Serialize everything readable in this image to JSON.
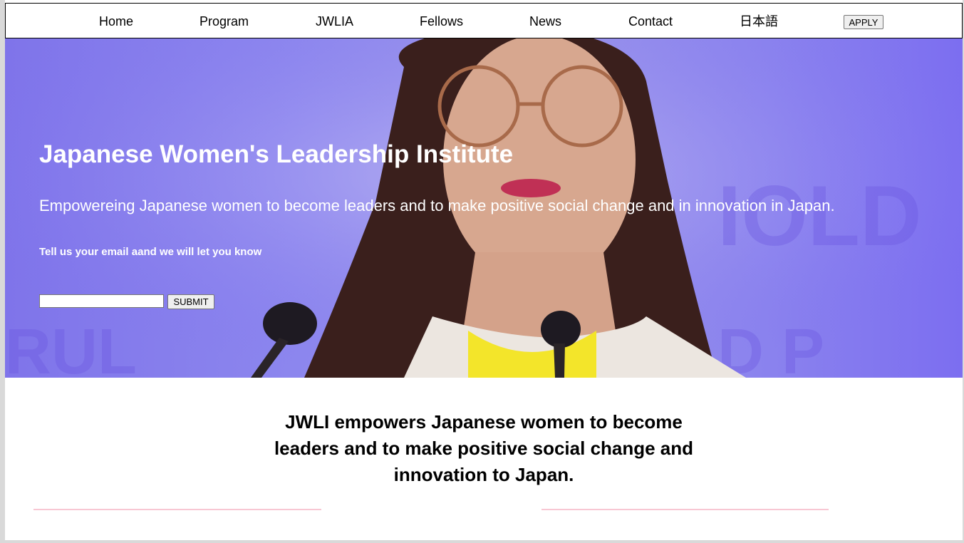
{
  "nav": {
    "items": [
      "Home",
      "Program",
      "JWLIA",
      "Fellows",
      "News",
      "Contact",
      "日本語"
    ],
    "apply_label": "APPLY"
  },
  "hero": {
    "title": "Japanese Women's Leadership Institute",
    "subtitle": "Empowereing Japanese women to become leaders and to make positive social change and in innovation in Japan.",
    "email_prompt": "Tell us your email aand we will let you know",
    "email_placeholder": "",
    "submit_label": "SUBMIT"
  },
  "mission": {
    "text": "JWLI empowers Japanese women to become leaders and to make positive social change and innovation to Japan."
  },
  "colors": {
    "hero_overlay": "#8a82ee",
    "divider": "#f8c7d3"
  }
}
